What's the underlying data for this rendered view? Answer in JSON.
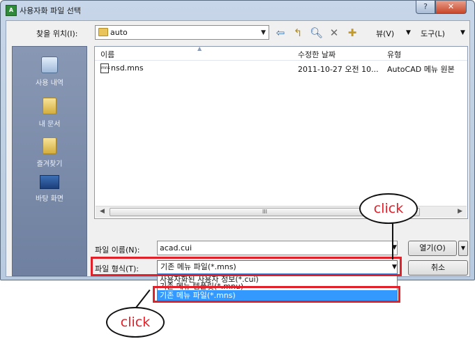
{
  "window": {
    "title": "사용자화 파일 선택",
    "app_icon": "autocad-icon",
    "help_label": "?",
    "close_label": "✕"
  },
  "toolbar": {
    "lookin_label": "찾을 위치(I):",
    "lookin_value": "auto",
    "view_menu": "뷰(V)",
    "tools_menu": "도구(L)"
  },
  "places": [
    {
      "label": "사용 내역",
      "icon": "recent-icon"
    },
    {
      "label": "내 문서",
      "icon": "documents-icon"
    },
    {
      "label": "즐겨찾기",
      "icon": "favorites-icon"
    },
    {
      "label": "바탕 화면",
      "icon": "desktop-icon"
    }
  ],
  "filelist": {
    "columns": [
      "이름",
      "수정한 날짜",
      "유형"
    ],
    "rows": [
      {
        "name": "nsd.mns",
        "date": "2011-10-27 오전 10...",
        "type": "AutoCAD 메뉴 원본"
      }
    ],
    "scroll_grip": "III"
  },
  "form": {
    "filename_label": "파일 이름(N):",
    "filename_value": "acad.cui",
    "open_button": "열기(O)",
    "filetype_label": "파일 형식(T):",
    "filetype_value": "기존 메뉴 파일(*.mns)",
    "cancel_button": "취소"
  },
  "dropdown": {
    "options": [
      "사용자화된 사용자 정보(*.cui)",
      "기존 메뉴 템플릿(*.mnu)",
      "기존 메뉴 파일(*.mns)"
    ],
    "selected_index": 2
  },
  "annotations": {
    "callout_top": "click",
    "callout_bottom": "click",
    "highlight_color": "#e1202a"
  },
  "colors": {
    "selection": "#3399ff",
    "places_bar": "#7a8aa6"
  }
}
